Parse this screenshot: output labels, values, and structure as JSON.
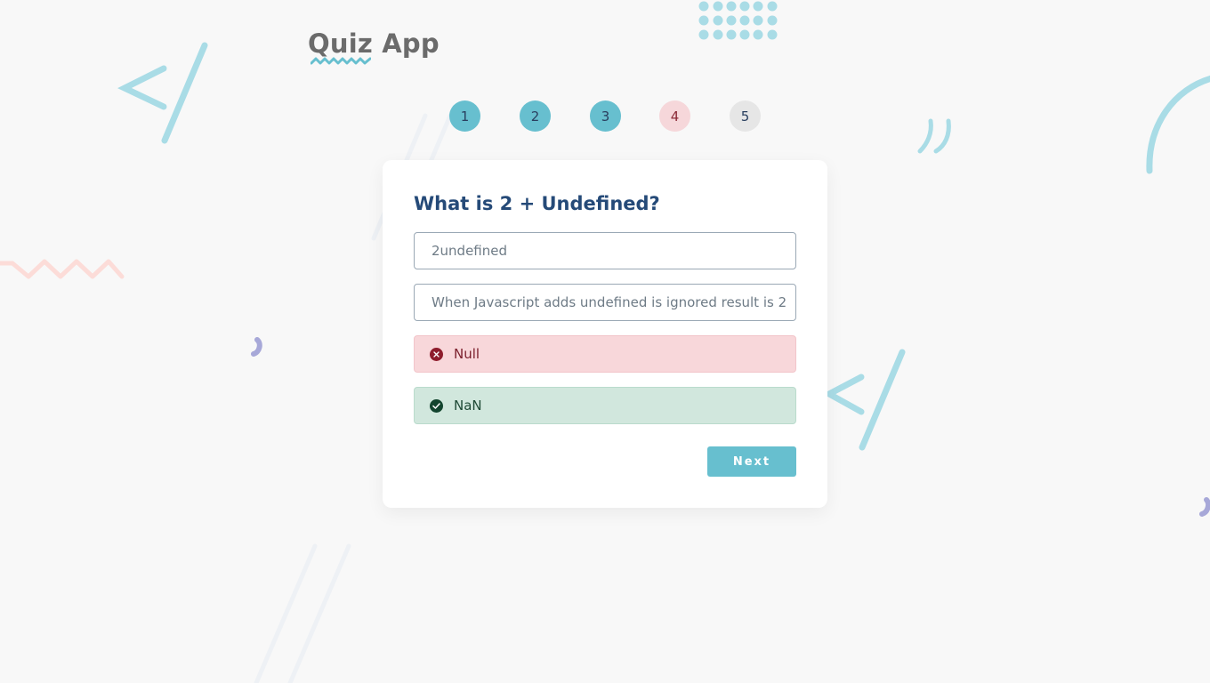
{
  "app": {
    "title": "Quiz App"
  },
  "steps": [
    {
      "label": "1",
      "state": "done"
    },
    {
      "label": "2",
      "state": "done"
    },
    {
      "label": "3",
      "state": "done"
    },
    {
      "label": "4",
      "state": "wrong"
    },
    {
      "label": "5",
      "state": "pending"
    }
  ],
  "quiz": {
    "question": "What is 2 + Undefined?",
    "options": [
      {
        "label": "2undefined",
        "state": "neutral"
      },
      {
        "label": "When Javascript adds undefined is ignored result is 2",
        "state": "neutral"
      },
      {
        "label": "Null",
        "state": "wrong",
        "icon": "x-circle-icon"
      },
      {
        "label": "NaN",
        "state": "correct",
        "icon": "check-circle-icon"
      }
    ],
    "next_label": "Next"
  },
  "colors": {
    "accent": "#67bfcf",
    "title_text": "#254a78",
    "wrong_bg": "#f8d7da",
    "correct_bg": "#d1e7dd",
    "background": "#f8f8f8"
  }
}
